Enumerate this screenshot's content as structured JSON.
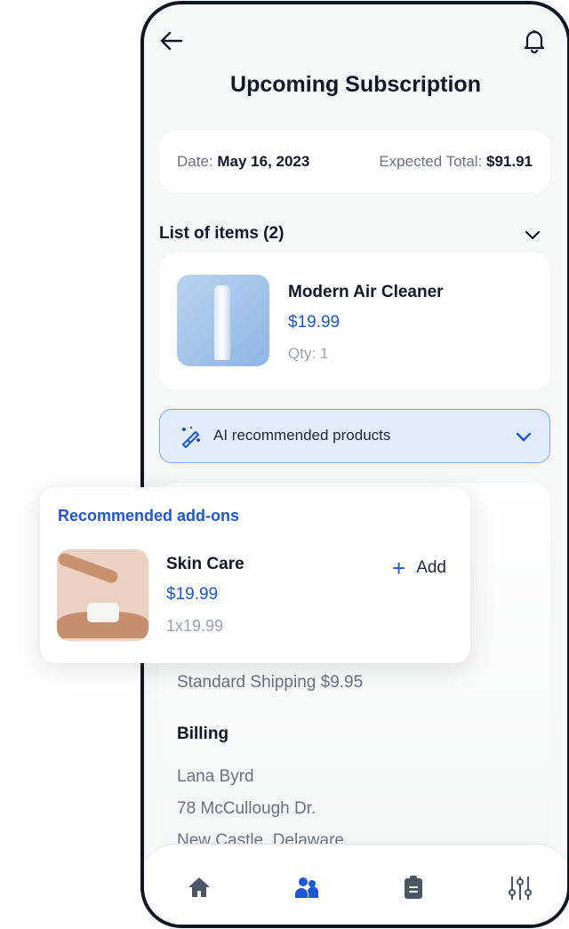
{
  "header": {
    "title": "Upcoming Subscription",
    "back_icon": "arrow-left-icon",
    "notification_icon": "bell-icon"
  },
  "summary": {
    "date_label": "Date:",
    "date_value": "May 16, 2023",
    "total_label": "Expected Total:",
    "total_value": "$91.91"
  },
  "items": {
    "header": "List of items (2)",
    "list": [
      {
        "name": "Modern Air Cleaner",
        "price": "$19.99",
        "qty": "Qty: 1"
      }
    ]
  },
  "ai": {
    "label": "AI recommended products",
    "icon": "magic-wand-icon"
  },
  "addons": {
    "title": "Recommended add-ons",
    "item": {
      "name": "Skin Care",
      "price": "$19.99",
      "qty": "1x19.99",
      "add_label": "Add"
    }
  },
  "shipping": "Standard Shipping $9.95",
  "billing": {
    "title": "Billing",
    "lines": [
      "Lana Byrd",
      "78 McCullough Dr.",
      "New Castle, Delaware"
    ]
  },
  "nav": {
    "items": [
      "home-icon",
      "users-icon",
      "clipboard-icon",
      "sliders-icon"
    ],
    "active": 1
  },
  "colors": {
    "accent": "#1d57d8",
    "ai_bg": "#e1edfd",
    "frame": "#0f1724"
  }
}
